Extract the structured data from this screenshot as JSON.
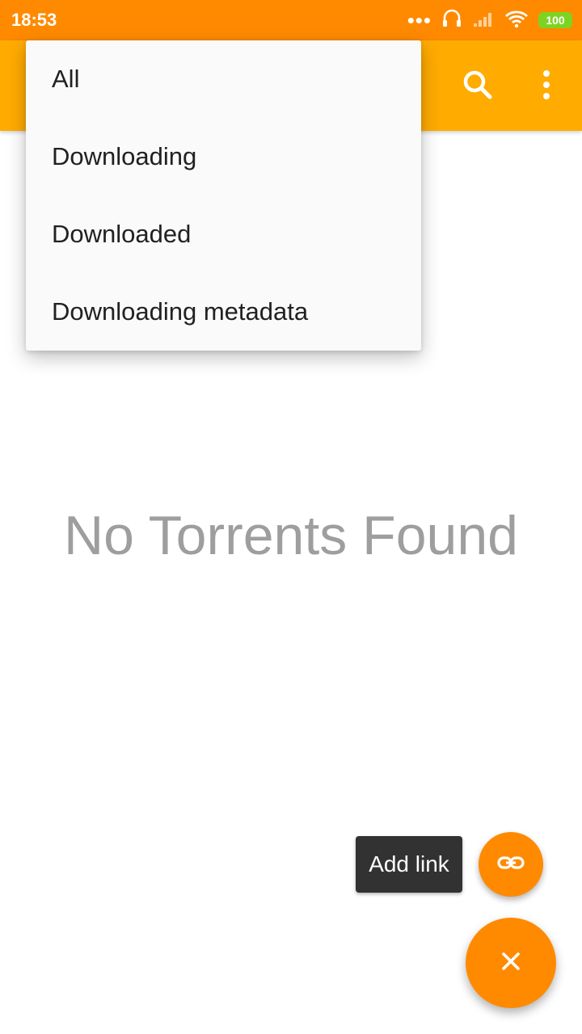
{
  "status_bar": {
    "time": "18:53",
    "battery": "100",
    "icons": [
      "more-dots-icon",
      "headset-icon",
      "signal-icon",
      "wifi-icon",
      "battery-icon"
    ]
  },
  "app_bar": {
    "actions": [
      "search-icon",
      "more-vert-icon"
    ]
  },
  "filter_menu": {
    "items": [
      {
        "label": "All"
      },
      {
        "label": "Downloading"
      },
      {
        "label": "Downloaded"
      },
      {
        "label": "Downloading metadata"
      }
    ]
  },
  "main": {
    "empty_message": "No Torrents Found"
  },
  "fab": {
    "tooltip": "Add link",
    "mini_icon": "link-icon",
    "main_icon": "close-icon"
  },
  "colors": {
    "status_bar": "#ff8a00",
    "app_bar": "#ffab00",
    "fab": "#ff8a00",
    "battery": "#7ed321"
  }
}
